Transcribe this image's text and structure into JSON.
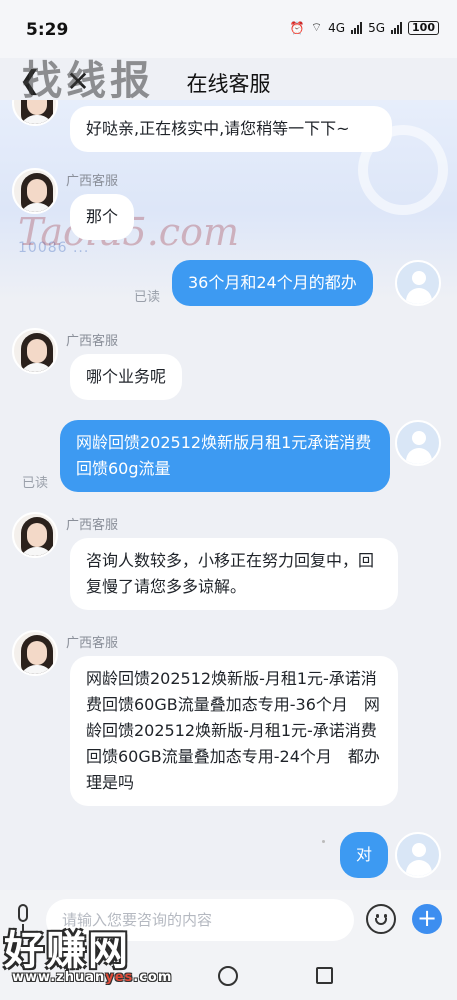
{
  "status_bar": {
    "time": "5:29",
    "net1": "4G",
    "net2": "5G",
    "battery": "100"
  },
  "header": {
    "title": "在线客服",
    "back_icon": "back-arrow-icon",
    "close_icon": "close-icon"
  },
  "watermarks": {
    "top": "找线报",
    "middle": "Taolu5.com",
    "banner_text": "10086 ...",
    "bottom_big": "好赚网",
    "bottom_small_1": "www.zhuan",
    "bottom_small_2": "yes",
    "bottom_small_3": ".com"
  },
  "messages": [
    {
      "side": "in",
      "text": "好哒亲,正在核实中,请您稍等一下下~"
    },
    {
      "side": "in",
      "sender": "广西客服",
      "text": "那个"
    },
    {
      "side": "out",
      "status": "已读",
      "text": "36个月和24个月的都办"
    },
    {
      "side": "in",
      "sender": "广西客服",
      "text": "哪个业务呢"
    },
    {
      "side": "out",
      "status": "已读",
      "text": "网龄回馈202512焕新版月租1元承诺消费回馈60g流量"
    },
    {
      "side": "in",
      "sender": "广西客服",
      "text": "咨询人数较多，小移正在努力回复中，回复慢了请您多多谅解。"
    },
    {
      "side": "in",
      "sender": "广西客服",
      "text": "网龄回馈202512焕新版-月租1元-承诺消费回馈60GB流量叠加态专用-36个月　网龄回馈202512焕新版-月租1元-承诺消费回馈60GB流量叠加态专用-24个月　都办理是吗"
    },
    {
      "side": "out",
      "text": "对"
    }
  ],
  "input_bar": {
    "placeholder": "请输入您要咨询的内容",
    "plus_label": "+"
  },
  "colors": {
    "accent": "#3d9af2",
    "incoming_bubble": "#ffffff",
    "background": "#eef0f5"
  }
}
